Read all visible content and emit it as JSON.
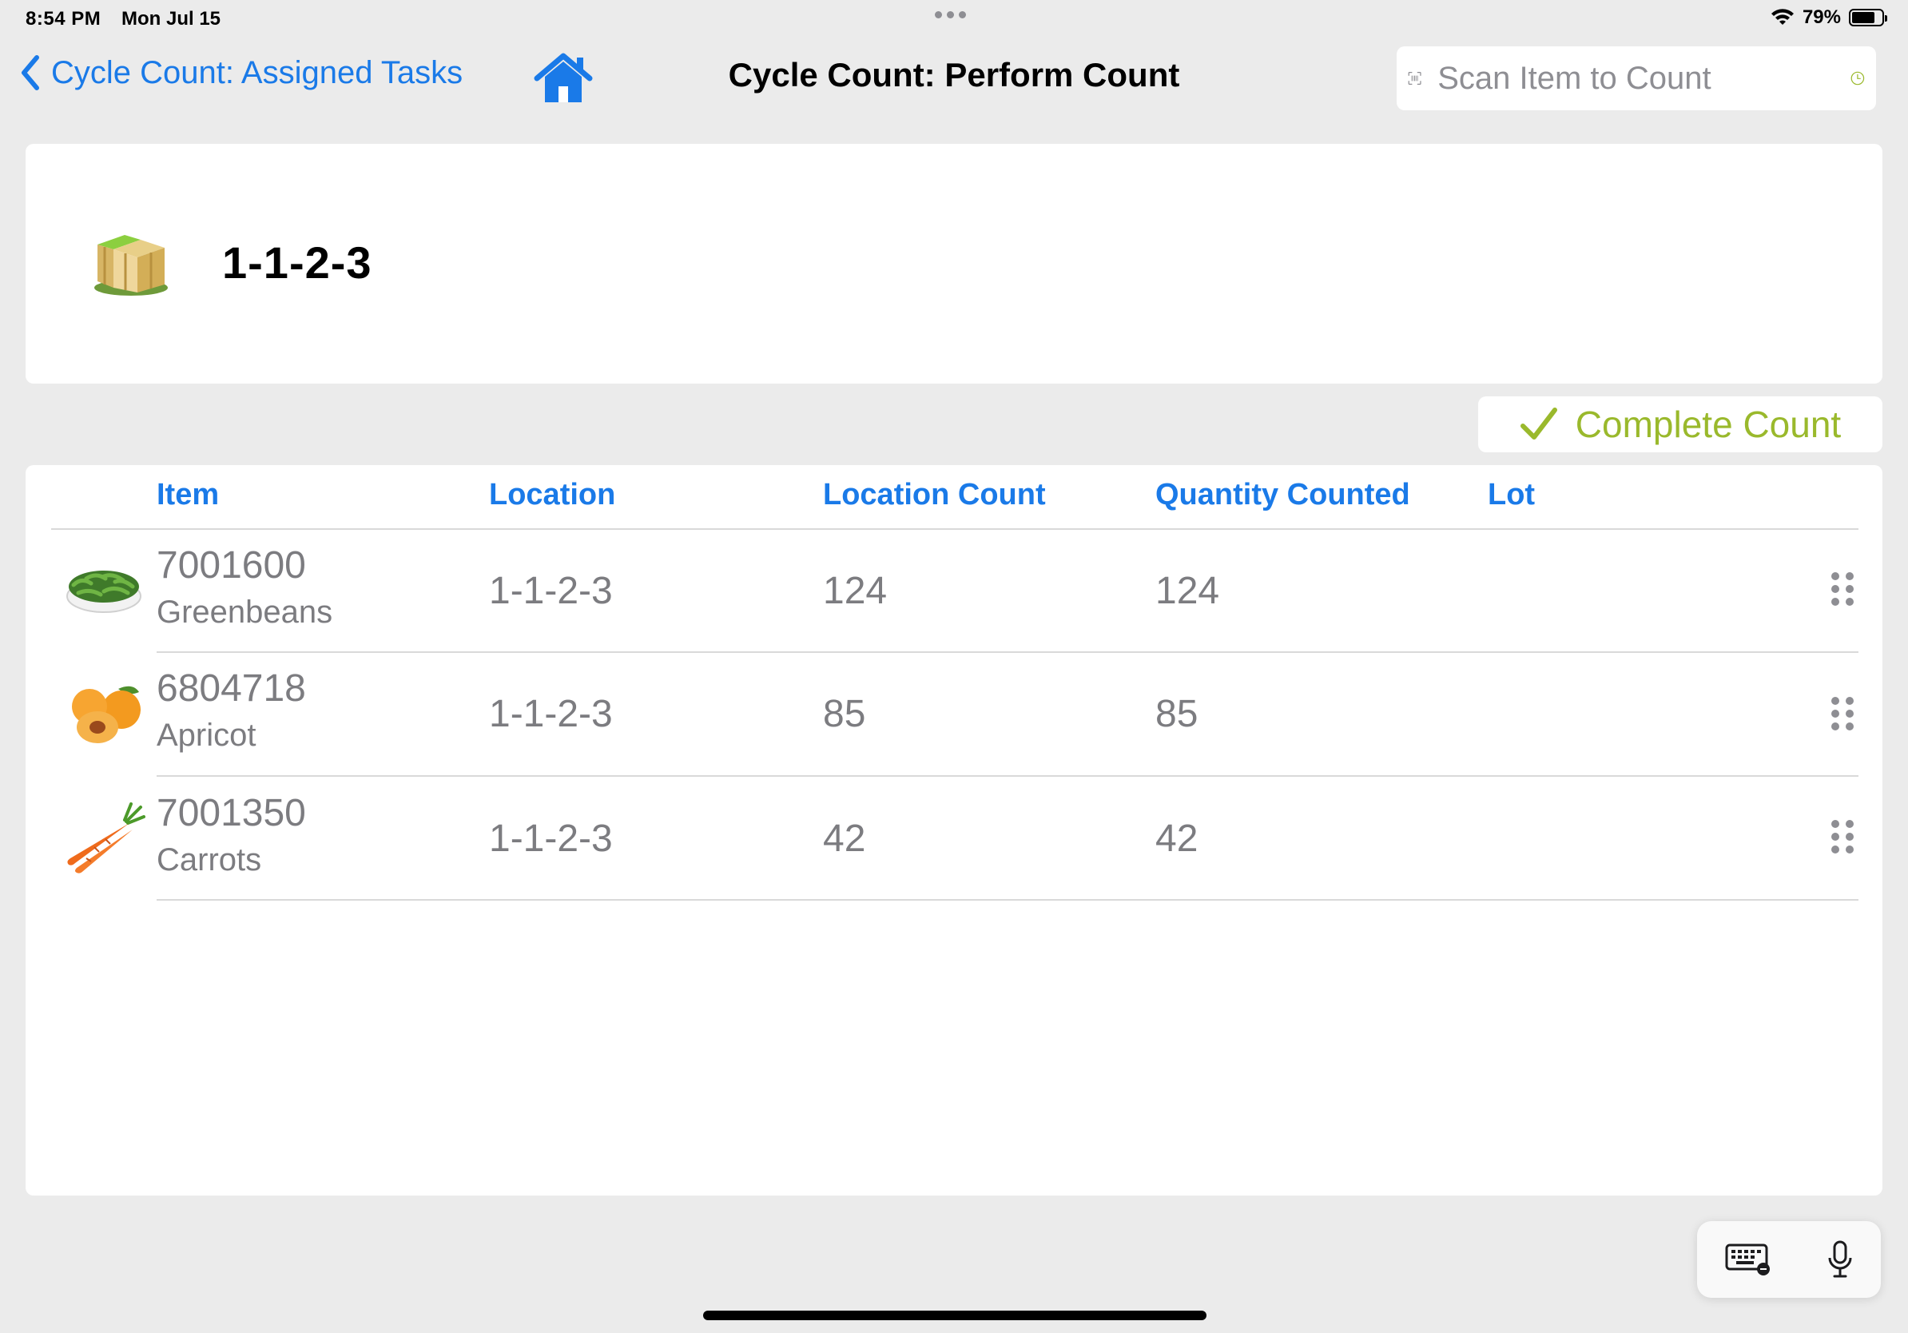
{
  "status_bar": {
    "time": "8:54 PM",
    "date": "Mon Jul 15",
    "battery": "79%",
    "icons": [
      "wifi-icon",
      "battery-icon"
    ]
  },
  "nav": {
    "back_label": "Cycle Count: Assigned Tasks",
    "title": "Cycle Count: Perform Count",
    "scan_placeholder": "Scan Item to Count",
    "icons": [
      "chevron-left-icon",
      "home-icon",
      "barcode-scan-icon",
      "clock-icon"
    ]
  },
  "location": {
    "code": "1-1-2-3",
    "icon": "boxes-icon"
  },
  "actions": {
    "complete_label": "Complete Count"
  },
  "table": {
    "headers": [
      "Item",
      "Location",
      "Location Count",
      "Quantity Counted",
      "Lot"
    ],
    "rows": [
      {
        "item_no": "7001600",
        "item_name": "Greenbeans",
        "location": "1-1-2-3",
        "location_count": "124",
        "quantity_counted": "124",
        "lot": "",
        "thumb": "greenbeans-thumbnail"
      },
      {
        "item_no": "6804718",
        "item_name": "Apricot",
        "location": "1-1-2-3",
        "location_count": "85",
        "quantity_counted": "85",
        "lot": "",
        "thumb": "apricot-thumbnail"
      },
      {
        "item_no": "7001350",
        "item_name": "Carrots",
        "location": "1-1-2-3",
        "location_count": "42",
        "quantity_counted": "42",
        "lot": "",
        "thumb": "carrots-thumbnail"
      }
    ]
  },
  "keyboard_toolbar": {
    "icons": [
      "keyboard-icon",
      "microphone-icon"
    ]
  },
  "colors": {
    "accent": "#1a7ae8",
    "complete": "#9ab92c",
    "background": "#ebebeb",
    "secondary_text": "#7c7c80"
  }
}
